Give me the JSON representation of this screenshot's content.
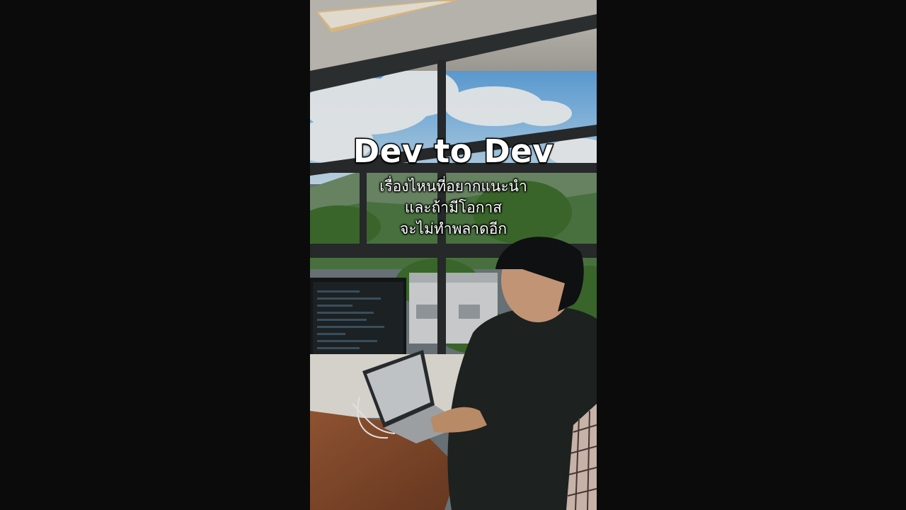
{
  "video": {
    "caption": {
      "title": "Dev to Dev",
      "lines": [
        "เรื่องไหนที่อยากแนะนำ",
        "และถ้ามีโอกาส",
        "จะไม่ทำพลาดอีก"
      ]
    }
  }
}
